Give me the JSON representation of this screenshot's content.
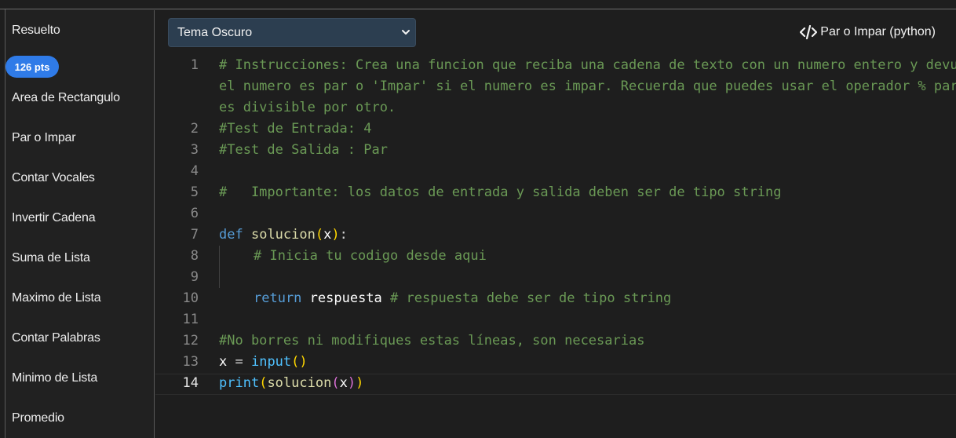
{
  "sidebar": {
    "items": [
      {
        "label": "Resuelto"
      },
      {
        "label": "Area de Rectangulo"
      },
      {
        "label": "Par o Impar"
      },
      {
        "label": "Contar Vocales"
      },
      {
        "label": "Invertir Cadena"
      },
      {
        "label": "Suma de Lista"
      },
      {
        "label": "Maximo de Lista"
      },
      {
        "label": "Contar Palabras"
      },
      {
        "label": "Minimo de Lista"
      },
      {
        "label": "Promedio"
      }
    ],
    "badge": "126 pts"
  },
  "toolbar": {
    "theme_selected": "Tema Oscuro",
    "title": "Par o Impar (python)",
    "title_icon": "code-icon"
  },
  "editor": {
    "active_line": "14",
    "line_numbers": [
      "1",
      "2",
      "3",
      "4",
      "5",
      "6",
      "7",
      "8",
      "9",
      "10",
      "11",
      "12",
      "13",
      "14"
    ],
    "lines": {
      "l1a": "# Instrucciones: Crea una funcion que reciba una cadena de texto con un numero entero y devuelva 'Par' si",
      "l1b": "el numero es par o 'Impar' si el numero es impar. Recuerda que puedes usar el operador % para saber si un numero",
      "l1c": "es divisible por otro.",
      "l2": "#Test de Entrada: 4",
      "l3": "#Test de Salida : Par",
      "l5": "#   Importante: los datos de entrada y salida deben ser de tipo string",
      "l7_kw": "def",
      "l7_fn": "solucion",
      "l7_arg": "x",
      "l8": "# Inicia tu codigo desde aqui",
      "l10_kw": "return",
      "l10_id": "respuesta",
      "l10_cm": "# respuesta debe ser de tipo string",
      "l12": "#No borres ni modifiques estas líneas, son necesarias",
      "l13_id": "x",
      "l13_fn": "input",
      "l14_fn": "print",
      "l14_fn2": "solucion",
      "l14_arg": "x"
    }
  },
  "colors": {
    "background": "#1e1e1e",
    "badge": "#2f7be8",
    "select": "#2c3e50",
    "comment": "#6a9955",
    "keyword": "#569cd6"
  }
}
